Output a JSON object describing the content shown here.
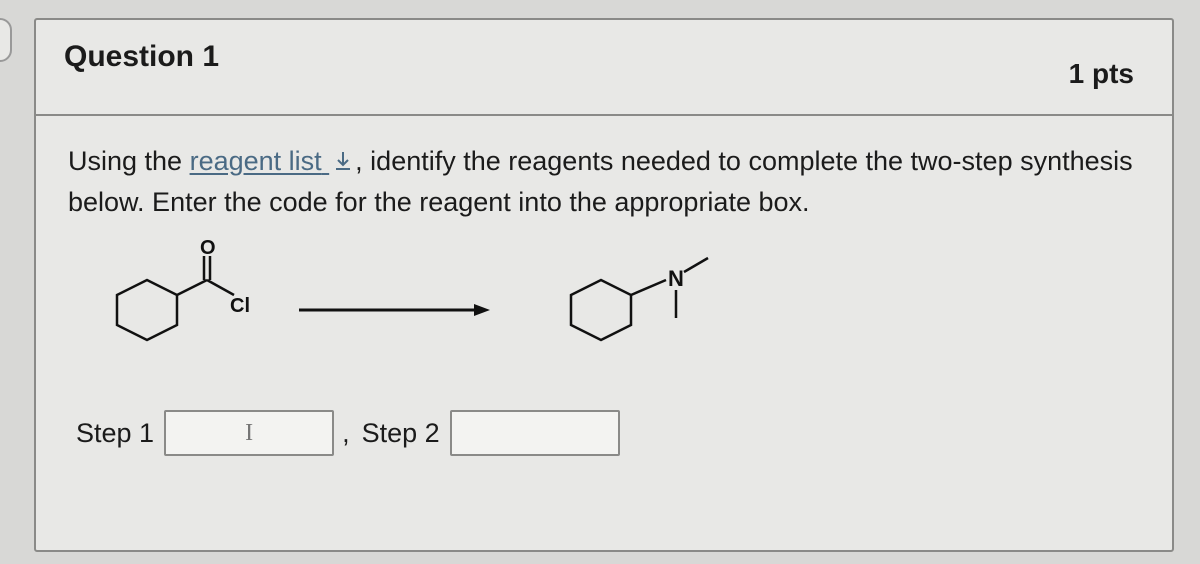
{
  "header": {
    "title": "Question 1",
    "points": "1 pts"
  },
  "prompt": {
    "prefix": "Using the ",
    "link_text": "reagent list",
    "after_link": ", identify the reagents needed to complete the two-step synthesis below. Enter the code for the reagent into the appropriate box."
  },
  "structures": {
    "start_O": "O",
    "start_Cl": "Cl",
    "product_N": "N"
  },
  "steps": {
    "step1_label": "Step 1",
    "step1_value": "",
    "step1_placeholder": "I",
    "comma": ",",
    "step2_label": "Step 2",
    "step2_value": "",
    "step2_placeholder": ""
  }
}
